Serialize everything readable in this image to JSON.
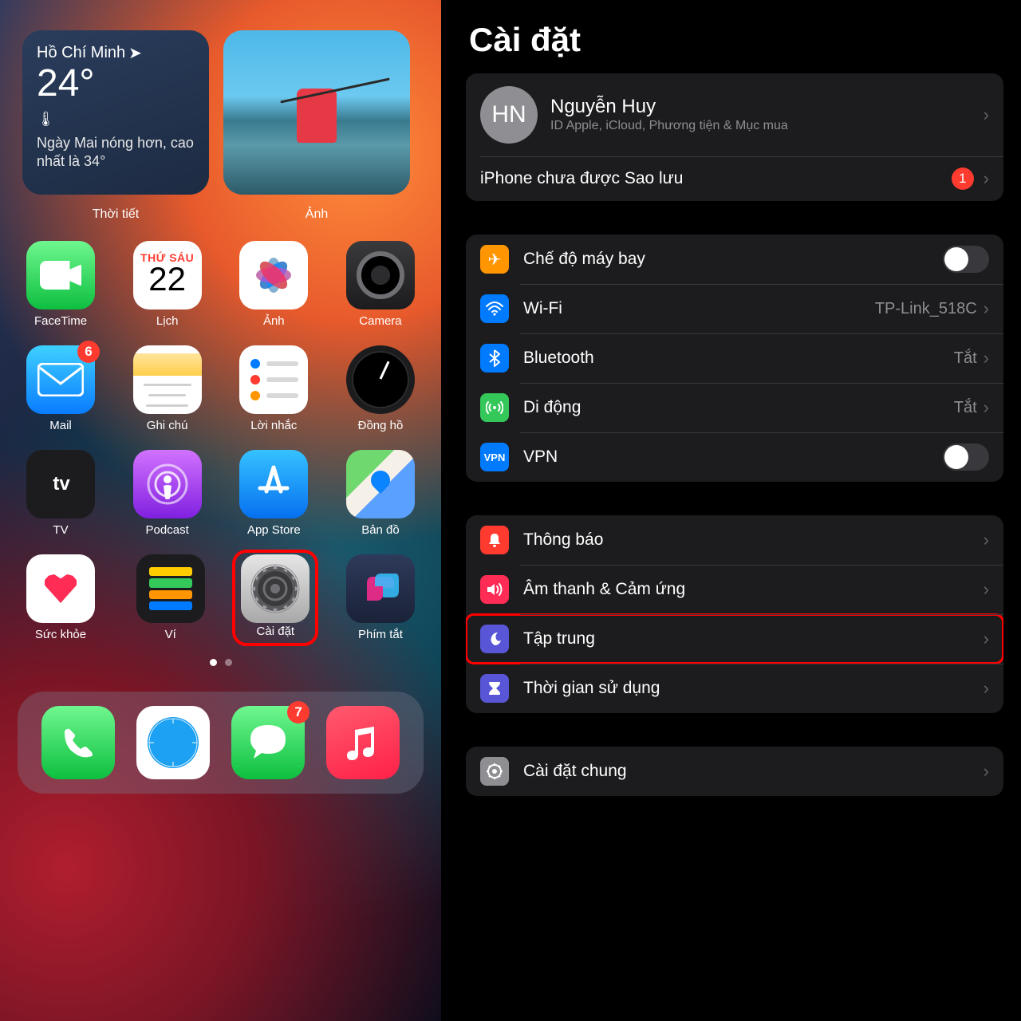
{
  "homescreen": {
    "weather": {
      "location": "Hồ Chí Minh",
      "temp": "24°",
      "forecast": "Ngày Mai nóng hơn, cao nhất là 34°",
      "widget_label": "Thời tiết"
    },
    "photo_widget_label": "Ảnh",
    "calendar": {
      "dow": "THỨ SÁU",
      "day": "22"
    },
    "apps": {
      "facetime": "FaceTime",
      "calendar": "Lịch",
      "photos": "Ảnh",
      "camera": "Camera",
      "mail": "Mail",
      "mail_badge": "6",
      "notes": "Ghi chú",
      "reminders": "Lời nhắc",
      "clock": "Đồng hồ",
      "tv": "TV",
      "podcast": "Podcast",
      "appstore": "App Store",
      "maps": "Bản đồ",
      "health": "Sức khỏe",
      "wallet": "Ví",
      "settings": "Cài đặt",
      "shortcuts": "Phím tắt"
    },
    "dock": {
      "messages_badge": "7"
    },
    "tv_text": "tv"
  },
  "settings": {
    "title": "Cài đặt",
    "profile": {
      "initials": "HN",
      "name": "Nguyễn Huy",
      "subtitle": "ID Apple, iCloud, Phương tiện & Mục mua"
    },
    "backup_row": {
      "label": "iPhone chưa được Sao lưu",
      "badge": "1"
    },
    "rows": {
      "airplane": "Chế độ máy bay",
      "wifi": "Wi-Fi",
      "wifi_value": "TP-Link_518C",
      "bluetooth": "Bluetooth",
      "bluetooth_value": "Tắt",
      "cellular": "Di động",
      "cellular_value": "Tắt",
      "vpn": "VPN",
      "vpn_icon": "VPN",
      "notifications": "Thông báo",
      "sounds": "Âm thanh & Cảm ứng",
      "focus": "Tập trung",
      "screentime": "Thời gian sử dụng",
      "general": "Cài đặt chung"
    }
  }
}
